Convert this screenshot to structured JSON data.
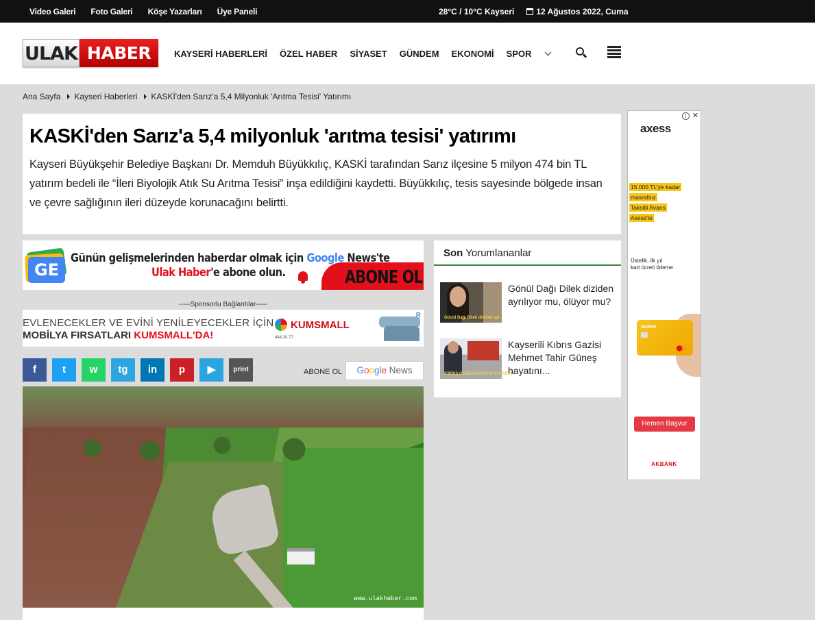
{
  "topbar": {
    "links": [
      "Video Galeri",
      "Foto Galeri",
      "Köşe Yazarları",
      "Üye Paneli"
    ],
    "weather": "28°C / 10°C Kayseri",
    "date": "12 Ağustos 2022, Cuma"
  },
  "logo": {
    "part1": "ULAK",
    "part2": "HABER"
  },
  "nav": {
    "items": [
      "KAYSERİ HABERLERİ",
      "ÖZEL HABER",
      "SİYASET",
      "GÜNDEM",
      "EKONOMİ",
      "SPOR"
    ]
  },
  "breadcrumb": [
    "Ana Sayfa",
    "Kayseri Haberleri",
    "KASKİ'den Sarız'a 5,4 Milyonluk 'Arıtma Tesisi' Yatırımı"
  ],
  "article": {
    "title": "KASKİ'den Sarız'a 5,4 milyonluk 'arıtma tesisi' yatırımı",
    "summary": "Kayseri Büyükşehir Belediye Başkanı Dr. Memduh Büyükkılıç, KASKİ tarafından Sarız ilçesine 5 milyon 474 bin TL yatırım bedeli ile “İleri Biyolojik Atık Su Arıtma Tesisi” inşa edildiğini kaydetti. Büyükkılıç, tesis sayesinde bölgede insan ve çevre sağlığının ileri düzeyde korunacağını belirtti.",
    "image_watermark": "www.ulakhaber.com"
  },
  "gnews_banner": {
    "ge": "GE",
    "line1_a": "Günün gelişmelerinden haberdar olmak için ",
    "line1_google": "Google",
    "line1_b": " News'te",
    "line2_brand": "Ulak Haber",
    "line2_b": "'e abone olun.",
    "button": "ABONE OL"
  },
  "sponsor_label": "-----Sponsorlu Bağlantılar-----",
  "kums_banner": {
    "line1": "EVLENECEKLER VE EVİNİ YENİLEYECEKLER İÇİN",
    "line2_a": "MOBİLYA FIRSATLARI ",
    "line2_b": "KUMSMALL'DA!",
    "logo": "KUMSMALL",
    "phone": "444 20 77",
    "mark": "R"
  },
  "share": {
    "buttons": [
      "f",
      "t",
      "w",
      "tg",
      "in",
      "p",
      "▶",
      "print"
    ],
    "colors": [
      "#3b5998",
      "#1da1f2",
      "#25d366",
      "#2ca5e0",
      "#0077b5",
      "#cb2027",
      "#2ba4e0",
      "#555555"
    ],
    "subscribe_label": "ABONE OL",
    "google_news": {
      "google": "Google",
      "news": " News"
    }
  },
  "comments": {
    "title_bold": "Son",
    "title_rest": " Yorumlananlar",
    "items": [
      {
        "text": "Gönül Dağı Dilek diziden ayrılıyor mu, ölüyor mu?",
        "caption": "Gönül Dağı Dilek diziden ayr..."
      },
      {
        "text": "Kayserili Kıbrıs Gazisi Mehmet Tahir Güneş hayatını...",
        "caption": "KIBRIS GAZİSİ HAYATINI KAYBETTİ"
      }
    ]
  },
  "ad": {
    "brand": "axess",
    "highlights": [
      "15.000 TL'ye kadar",
      "masrafsız",
      "Taksitli Avans",
      "Axess'te"
    ],
    "sub1": "Üstelik, ilk yıl",
    "sub2": "kart ücreti ödeme",
    "card_brand": "axess",
    "cta": "Hemen Başvur",
    "bank": "AKBANK",
    "info": "i",
    "close": "✕"
  }
}
